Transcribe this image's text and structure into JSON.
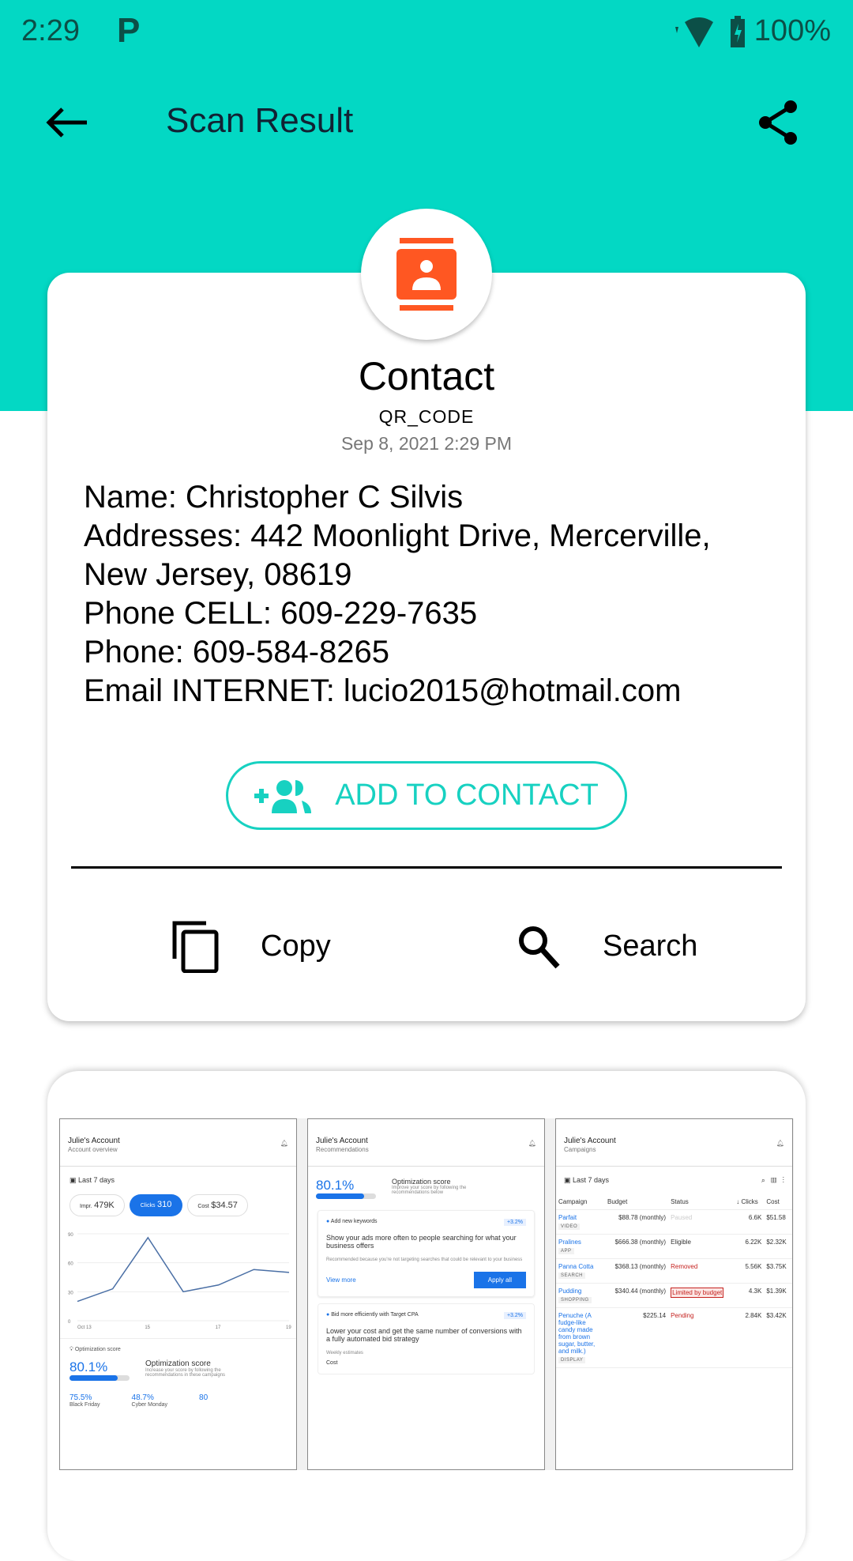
{
  "status": {
    "time": "2:29",
    "notif": "P",
    "battery": "100%"
  },
  "toolbar": {
    "title": "Scan Result"
  },
  "result": {
    "title": "Contact",
    "type": "QR_CODE",
    "date": "Sep 8, 2021 2:29 PM",
    "lines": [
      "Name: Christopher C Silvis",
      "Addresses: 442 Moonlight Drive, Mercerville,",
      "New Jersey, 08619",
      "Phone CELL: 609-229-7635",
      "Phone: 609-584-8265",
      "Email INTERNET: lucio2015@hotmail.com"
    ],
    "add_label": "ADD TO CONTACT",
    "copy_label": "Copy",
    "search_label": "Search"
  },
  "colors": {
    "accent": "#03d8c4",
    "icon": "#ff5722"
  },
  "ad": {
    "p1": {
      "account": "Julie's Account",
      "sub": "Account overview",
      "range": "Last 7 days",
      "impr_l": "Impr.",
      "impr": "479K",
      "clicks_l": "Clicks",
      "clicks": "310",
      "cost_l": "Cost",
      "cost": "$34.57",
      "y_ticks": [
        "90",
        "60",
        "30",
        "0"
      ],
      "x_ticks": [
        "Oct 13",
        "15",
        "17",
        "19"
      ],
      "values": [
        20,
        33,
        86,
        30,
        37,
        53,
        50
      ],
      "opt_l": "Optimization score",
      "score": "80.1%",
      "opt_title": "Optimization score",
      "opt_desc": "Increase your score by following the recommendations in these campaigns",
      "s1": "75.5%",
      "s1l": "Black Friday",
      "s2": "48.7%",
      "s2l": "Cyber Monday",
      "s3": "80"
    },
    "p2": {
      "account": "Julie's Account",
      "sub": "Recommendations",
      "score": "80.1%",
      "opt_title": "Optimization score",
      "opt_desc": "Improve your score by following the recommendations below",
      "r1": {
        "title": "Add new keywords",
        "badge": "+3.2%",
        "head": "Show your ads more often to people searching for what your business offers",
        "desc": "Recommended because you're not targeting searches that could be relevant to your business",
        "more": "View more",
        "apply": "Apply all"
      },
      "r2": {
        "title": "Bid more efficiently with Target CPA",
        "badge": "+3.2%",
        "head": "Lower your cost and get the same number of conversions with a fully automated bid strategy",
        "est": "Weekly estimates",
        "cost": "Cost"
      }
    },
    "p3": {
      "account": "Julie's Account",
      "sub": "Campaigns",
      "range": "Last 7 days",
      "headers": [
        "Campaign",
        "Budget",
        "Status",
        "↓ Clicks",
        "Cost"
      ],
      "rows": [
        {
          "name": "Parfait",
          "tag": "VIDEO",
          "budget": "$88.78 (monthly)",
          "status": "Paused",
          "clicks": "6.6K",
          "cost": "$51.58"
        },
        {
          "name": "Pralines",
          "tag": "APP",
          "budget": "$666.38 (monthly)",
          "status": "Eligible",
          "clicks": "6.22K",
          "cost": "$2.32K"
        },
        {
          "name": "Panna Cotta",
          "tag": "SEARCH",
          "budget": "$368.13 (monthly)",
          "status": "Removed",
          "clicks": "5.56K",
          "cost": "$3.75K"
        },
        {
          "name": "Pudding",
          "tag": "SHOPPING",
          "budget": "$340.44 (monthly)",
          "status": "Limited by budget",
          "clicks": "4.3K",
          "cost": "$1.39K"
        },
        {
          "name": "Penuche (A fudge-like candy made from brown sugar, butter, and milk.)",
          "tag": "DISPLAY",
          "budget": "$225.14",
          "status": "Pending",
          "clicks": "2.84K",
          "cost": "$3.42K"
        }
      ]
    }
  }
}
